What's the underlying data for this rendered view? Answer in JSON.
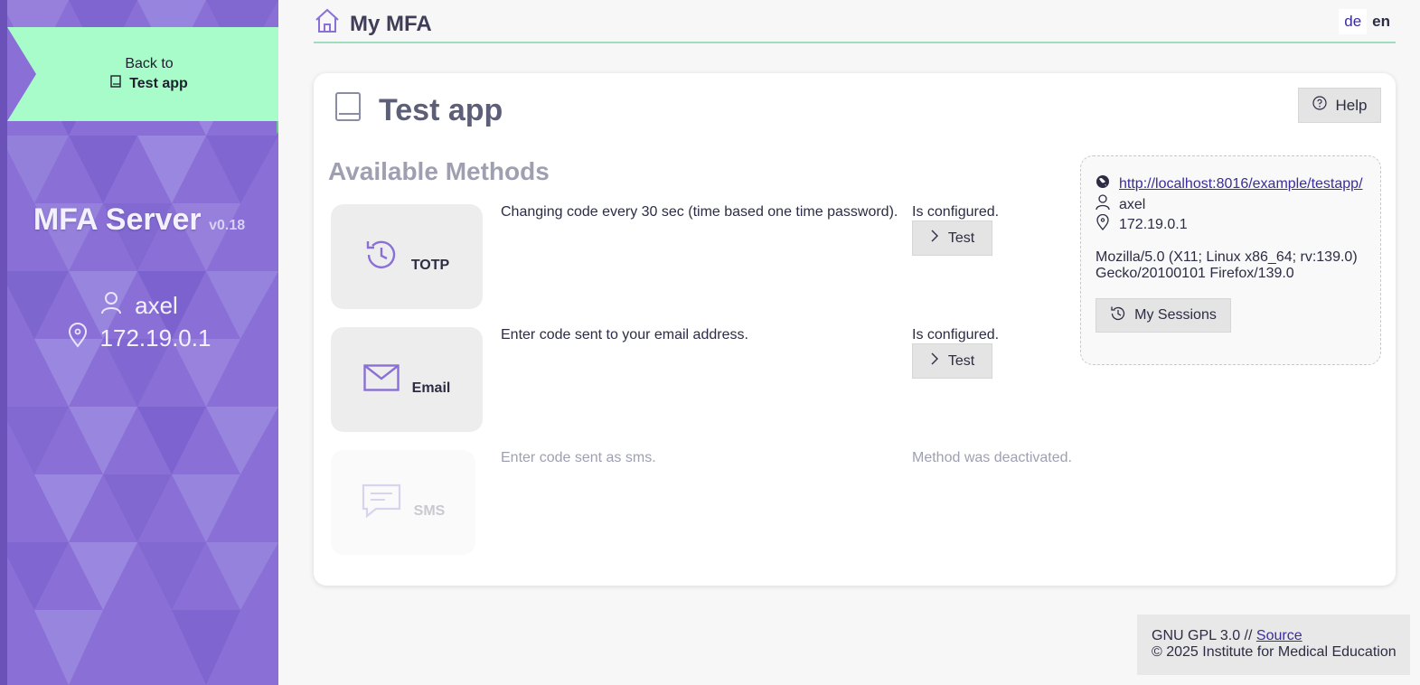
{
  "sidebar": {
    "back_label": "Back to",
    "back_app": "Test app",
    "brand_name": "MFA Server",
    "brand_version": "v0.18",
    "user": "axel",
    "ip": "172.19.0.1"
  },
  "header": {
    "title": "My MFA",
    "lang_de": "de",
    "lang_en": "en"
  },
  "card": {
    "title": "Test app",
    "help_label": "Help",
    "section_title": "Available Methods",
    "test_label": "Test",
    "methods": [
      {
        "name": "TOTP",
        "description": "Changing code every 30 sec (time based one time password).",
        "status": "Is configured.",
        "icon": "history-icon",
        "enabled": true
      },
      {
        "name": "Email",
        "description": "Enter code sent to your email address.",
        "status": "Is configured.",
        "icon": "mail-icon",
        "enabled": true
      },
      {
        "name": "SMS",
        "description": "Enter code sent as sms.",
        "status": "Method was deactivated.",
        "icon": "chat-icon",
        "enabled": false
      }
    ]
  },
  "session": {
    "url": "http://localhost:8016/example/testapp/",
    "user": "axel",
    "ip": "172.19.0.1",
    "user_agent_line1": "Mozilla/5.0 (X11; Linux x86_64; rv:139.0)",
    "user_agent_line2": "Gecko/20100101 Firefox/139.0",
    "sessions_label": "My Sessions"
  },
  "footer": {
    "license": "GNU GPL 3.0 // ",
    "source_label": "Source",
    "copyright": "© 2025 Institute for Medical Education"
  },
  "colors": {
    "accent": "#8a70d6",
    "ribbon": "#a7fcc9",
    "header_rule": "#9fdcc0",
    "link": "#3a2d9b"
  }
}
